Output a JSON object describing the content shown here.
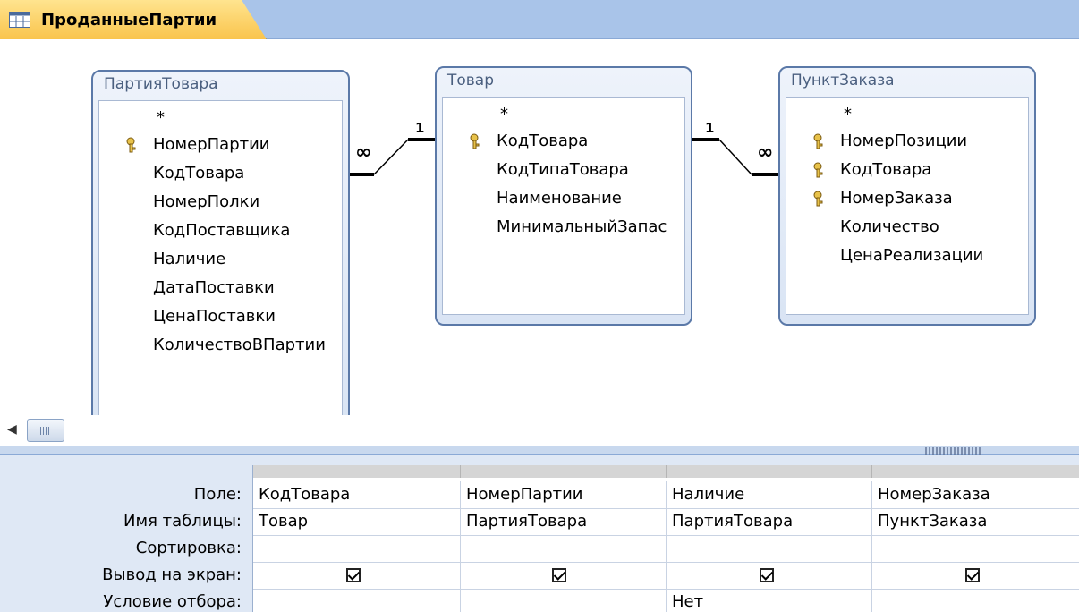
{
  "tab": {
    "title": "ПроданныеПартии",
    "icon": "query-icon"
  },
  "tables": [
    {
      "name": "ПартияТовара",
      "star": "*",
      "fields": [
        {
          "name": "НомерПартии",
          "key": true
        },
        {
          "name": "КодТовара",
          "key": false
        },
        {
          "name": "НомерПолки",
          "key": false
        },
        {
          "name": "КодПоставщика",
          "key": false
        },
        {
          "name": "Наличие",
          "key": false
        },
        {
          "name": "ДатаПоставки",
          "key": false
        },
        {
          "name": "ЦенаПоставки",
          "key": false
        },
        {
          "name": "КоличествоВПартии",
          "key": false
        }
      ]
    },
    {
      "name": "Товар",
      "star": "*",
      "fields": [
        {
          "name": "КодТовара",
          "key": true
        },
        {
          "name": "КодТипаТовара",
          "key": false
        },
        {
          "name": "Наименование",
          "key": false
        },
        {
          "name": "МинимальныйЗапас",
          "key": false
        }
      ]
    },
    {
      "name": "ПунктЗаказа",
      "star": "*",
      "fields": [
        {
          "name": "НомерПозиции",
          "key": true
        },
        {
          "name": "КодТовара",
          "key": true
        },
        {
          "name": "НомерЗаказа",
          "key": true
        },
        {
          "name": "Количество",
          "key": false
        },
        {
          "name": "ЦенаРеализации",
          "key": false
        }
      ]
    }
  ],
  "relations": [
    {
      "many_label": "∞",
      "one_label": "1"
    },
    {
      "one_label": "1",
      "many_label": "∞"
    }
  ],
  "grid": {
    "row_labels": [
      "Поле:",
      "Имя таблицы:",
      "Сортировка:",
      "Вывод на экран:",
      "Условие отбора:"
    ],
    "columns": [
      {
        "field": "КодТовара",
        "table": "Товар",
        "sort": "",
        "show": true,
        "criteria": ""
      },
      {
        "field": "НомерПартии",
        "table": "ПартияТовара",
        "sort": "",
        "show": true,
        "criteria": ""
      },
      {
        "field": "Наличие",
        "table": "ПартияТовара",
        "sort": "",
        "show": true,
        "criteria": "Нет"
      },
      {
        "field": "НомерЗаказа",
        "table": "ПунктЗаказа",
        "sort": "",
        "show": true,
        "criteria": ""
      }
    ]
  },
  "colors": {
    "tab_bar": "#a9c4e9",
    "tab_active": "#f9c44c",
    "table_border": "#5b79a8",
    "grid_bg": "#dfe8f5"
  }
}
